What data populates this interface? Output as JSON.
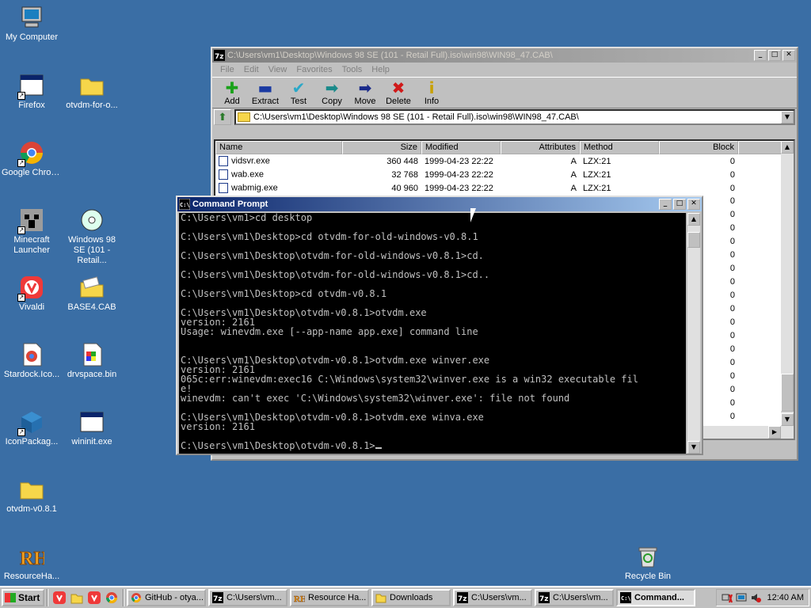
{
  "desktop_icons": [
    {
      "name": "my-computer",
      "label": "My Computer"
    },
    {
      "name": "firefox",
      "label": "Firefox"
    },
    {
      "name": "otvdm-for-old",
      "label": "otvdm-for-o..."
    },
    {
      "name": "google-chrome",
      "label": "Google Chrome"
    },
    {
      "name": "minecraft",
      "label": "Minecraft Launcher"
    },
    {
      "name": "windows98se",
      "label": "Windows 98 SE (101 - Retail..."
    },
    {
      "name": "vivaldi",
      "label": "Vivaldi"
    },
    {
      "name": "base4cab",
      "label": "BASE4.CAB"
    },
    {
      "name": "stardock",
      "label": "Stardock.Ico..."
    },
    {
      "name": "drvspace",
      "label": "drvspace.bin"
    },
    {
      "name": "iconpackager",
      "label": "IconPackag..."
    },
    {
      "name": "wininit",
      "label": "wininit.exe"
    },
    {
      "name": "otvdm-folder",
      "label": "otvdm-v0.8.1"
    },
    {
      "name": "resourcehacker",
      "label": "ResourceHa..."
    },
    {
      "name": "recycle-bin",
      "label": "Recycle Bin"
    }
  ],
  "zip_window": {
    "title": "C:\\Users\\vm1\\Desktop\\Windows 98 SE (101 - Retail Full).iso\\win98\\WIN98_47.CAB\\",
    "menu": [
      "File",
      "Edit",
      "View",
      "Favorites",
      "Tools",
      "Help"
    ],
    "toolbar": [
      {
        "label": "Add",
        "icon": "plus-icon"
      },
      {
        "label": "Extract",
        "icon": "minus-icon"
      },
      {
        "label": "Test",
        "icon": "check-icon"
      },
      {
        "label": "Copy",
        "icon": "copy-arrow-icon"
      },
      {
        "label": "Move",
        "icon": "move-arrow-icon"
      },
      {
        "label": "Delete",
        "icon": "delete-x-icon"
      },
      {
        "label": "Info",
        "icon": "info-icon"
      }
    ],
    "address": "C:\\Users\\vm1\\Desktop\\Windows 98 SE (101 - Retail Full).iso\\win98\\WIN98_47.CAB\\",
    "columns": [
      "Name",
      "Size",
      "Modified",
      "Attributes",
      "Method",
      "Block"
    ],
    "rows": [
      {
        "name": "vidsvr.exe",
        "size": "360 448",
        "modified": "1999-04-23 22:22",
        "attr": "A",
        "method": "LZX:21",
        "block": "0"
      },
      {
        "name": "wab.exe",
        "size": "32 768",
        "modified": "1999-04-23 22:22",
        "attr": "A",
        "method": "LZX:21",
        "block": "0"
      },
      {
        "name": "wabmig.exe",
        "size": "40 960",
        "modified": "1999-04-23 22:22",
        "attr": "A",
        "method": "LZX:21",
        "block": "0"
      }
    ],
    "hidden_blocks": [
      "0",
      "0",
      "0",
      "0",
      "0",
      "0",
      "0",
      "0",
      "0",
      "0",
      "0",
      "0",
      "0",
      "0",
      "0",
      "0",
      "0"
    ]
  },
  "cmd_window": {
    "title": "Command Prompt",
    "lines": [
      "C:\\Users\\vm1>cd desktop",
      "",
      "C:\\Users\\vm1\\Desktop>cd otvdm-for-old-windows-v0.8.1",
      "",
      "C:\\Users\\vm1\\Desktop\\otvdm-for-old-windows-v0.8.1>cd.",
      "",
      "C:\\Users\\vm1\\Desktop\\otvdm-for-old-windows-v0.8.1>cd..",
      "",
      "C:\\Users\\vm1\\Desktop>cd otvdm-v0.8.1",
      "",
      "C:\\Users\\vm1\\Desktop\\otvdm-v0.8.1>otvdm.exe",
      "version: 2161",
      "Usage: winevdm.exe [--app-name app.exe] command line",
      "",
      "",
      "C:\\Users\\vm1\\Desktop\\otvdm-v0.8.1>otvdm.exe winver.exe",
      "version: 2161",
      "065c:err:winevdm:exec16 C:\\Windows\\system32\\winver.exe is a win32 executable fil",
      "e!",
      "winevdm: can't exec 'C:\\Windows\\system32\\winver.exe': file not found",
      "",
      "C:\\Users\\vm1\\Desktop\\otvdm-v0.8.1>otvdm.exe winva.exe",
      "version: 2161",
      "",
      "C:\\Users\\vm1\\Desktop\\otvdm-v0.8.1>"
    ]
  },
  "taskbar": {
    "start": "Start",
    "tasks": [
      {
        "label": "GitHub - otya...",
        "icon": "chrome-icon"
      },
      {
        "label": "C:\\Users\\vm...",
        "icon": "7zip-icon"
      },
      {
        "label": "Resource Ha...",
        "icon": "resourcehacker-icon"
      },
      {
        "label": "Downloads",
        "icon": "folder-icon"
      },
      {
        "label": "C:\\Users\\vm...",
        "icon": "7zip-icon"
      },
      {
        "label": "C:\\Users\\vm...",
        "icon": "7zip-icon"
      },
      {
        "label": "Command...",
        "icon": "cmd-icon",
        "active": true
      }
    ],
    "clock": "12:40 AM"
  }
}
